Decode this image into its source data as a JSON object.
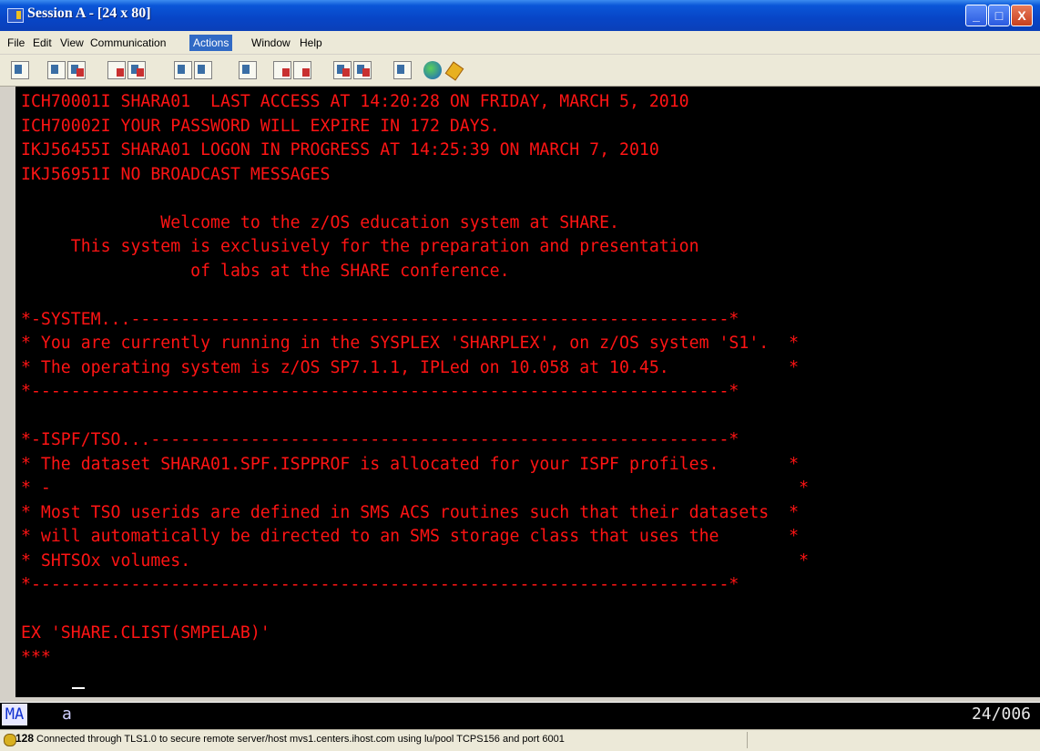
{
  "window": {
    "title": "Session A - [24 x 80]",
    "controls": {
      "minimize": "_",
      "maximize": "□",
      "close": "X"
    }
  },
  "menu": {
    "items": [
      {
        "label": "File"
      },
      {
        "label": "Edit"
      },
      {
        "label": "View"
      },
      {
        "label": "Communication"
      },
      {
        "label": "Actions",
        "active": true
      },
      {
        "label": "Window"
      },
      {
        "label": "Help"
      }
    ]
  },
  "toolbar": {
    "icons": [
      "print-screen-icon",
      "copy-icon",
      "paste-icon",
      "send-file-icon",
      "receive-file-icon",
      "display-setup-icon",
      "keyboard-map-icon",
      "macro-icon",
      "record-macro-icon",
      "play-macro-icon",
      "color-setup-icon",
      "color-remap-icon",
      "clipboard-icon",
      "help-globe-icon",
      "key-icon"
    ]
  },
  "terminal": {
    "colors": {
      "text": "#ff1414",
      "background": "#000000"
    },
    "lines": [
      "ICH70001I SHARA01  LAST ACCESS AT 14:20:28 ON FRIDAY, MARCH 5, 2010",
      "ICH70002I YOUR PASSWORD WILL EXPIRE IN 172 DAYS.",
      "IKJ56455I SHARA01 LOGON IN PROGRESS AT 14:25:39 ON MARCH 7, 2010",
      "IKJ56951I NO BROADCAST MESSAGES",
      "",
      "              Welcome to the z/OS education system at SHARE.",
      "     This system is exclusively for the preparation and presentation",
      "                 of labs at the SHARE conference.",
      "",
      "*-SYSTEM...------------------------------------------------------------*",
      "* You are currently running in the SYSPLEX 'SHARPLEX', on z/OS system 'S1'.  *",
      "* The operating system is z/OS SP7.1.1, IPLed on 10.058 at 10.45.            *",
      "*----------------------------------------------------------------------*",
      "",
      "*-ISPF/TSO...----------------------------------------------------------*",
      "* The dataset SHARA01.SPF.ISPPROF is allocated for your ISPF profiles.       *",
      "* -                                                                           *",
      "* Most TSO userids are defined in SMS ACS routines such that their datasets  *",
      "* will automatically be directed to an SMS storage class that uses the       *",
      "* SHTSOx volumes.                                                             *",
      "*----------------------------------------------------------------------*",
      "",
      "EX 'SHARE.CLIST(SMPELAB)'",
      "***"
    ]
  },
  "oia": {
    "mode": "MA",
    "indicator": "a",
    "cursor_position": "24/006"
  },
  "statusbar": {
    "code": "128",
    "message": "Connected through TLS1.0 to secure remote server/host mvs1.centers.ihost.com using lu/pool TCPS156 and port 6001"
  }
}
